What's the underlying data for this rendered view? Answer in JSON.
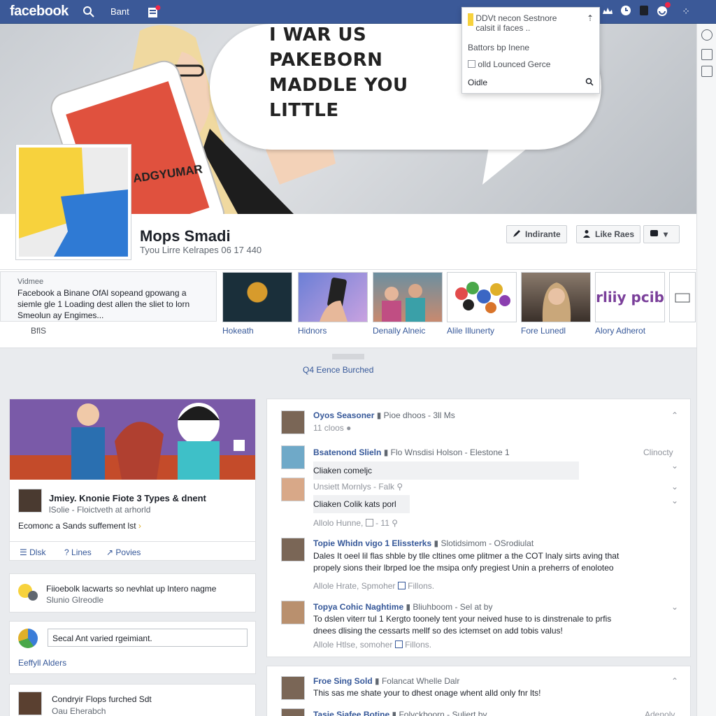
{
  "topbar": {
    "logo": "facebook",
    "home_label": "Bant"
  },
  "dropdown": {
    "row1": "DDVt necon Sestnore",
    "row1b": "calsit il faces ..",
    "row2": "Battors bp Inene",
    "row3": "olld Lounced Gerce",
    "row4": "Oidle"
  },
  "cover": {
    "bubble_line1": "I WAR US PAKEBORN",
    "bubble_line2": "MADDLE YOU LITTLE",
    "phone_text": "ADGYUMAR"
  },
  "profile": {
    "name": "Mops Smadi",
    "subtitle": "Tyou Lirre Kelrapes 06 17 440",
    "btn_edit": "Indirante",
    "btn_like": "Like Raes"
  },
  "about": {
    "title": "Vidmee",
    "text_line1": "Facebook a Binane OfAl sopeand gpowang a",
    "text_line2": "siemle gle 1 Loading dest allen the sliet to lorn",
    "text_line3": "Smeolun ay Engimes...",
    "link": "BflS"
  },
  "photos": [
    {
      "label": "Hokeath"
    },
    {
      "label": "Hidnors"
    },
    {
      "label": "Denally Alneic"
    },
    {
      "label": "Alile Illunerty"
    },
    {
      "label": "Fore Lunedl"
    },
    {
      "label": "Alory Adherot"
    }
  ],
  "photo6_text": "rliiy pcib",
  "timeline_link": "Q4 Eence Burched",
  "left_card1": {
    "title": "Jmiey. Knonie Fiote 3 Types & dnent",
    "sub": "lSolie - Floictveth at arhorld",
    "desc": "Ecomonc a Sands suffement lst",
    "action1": "Dlsk",
    "action2": "Lines",
    "action3": "Povies"
  },
  "left_card2": {
    "line1": "Fiioebolk lacwarts so nevhlat up lntero nagme",
    "line2": "Slunio Glreodle"
  },
  "left_card3": {
    "input_value": "Secal Ant varied rgeimiant.",
    "link": "Eeffyll Alders"
  },
  "left_card4": {
    "title": "Condryir Flops furched Sdt",
    "sub": "Oau Eherabch"
  },
  "feed": {
    "post1_title": "Oyos Seasoner",
    "post1_rest": "Pioe dhoos - 3ll Ms",
    "post1_sub": "11 cloos",
    "post2_title": "Bsatenond Slieln",
    "post2_rest": "Flo Wnsdisi Holson - Elestone 1",
    "post2_right": "Clinocty",
    "comment1": "Cliaken comeljc",
    "comment_meta1": "Unsiett Mornlys - Falk",
    "comment2": "Cliaken Colik kats porl",
    "comment_meta2": "Allolo Hunne,",
    "comment_meta2b": "- 11",
    "post3_title": "Topie Whidn vigo 1 Elissterks",
    "post3_rest": "Slotidsimom - OSrodiulat",
    "post3_line1": "Dales It oeel lil flas shble by tlle cltines ome plitmer a the COT lnaly sirts aving that",
    "post3_line2": "propely sions their lbrped loe the msipa onfy pregiest Unin a preherrs of enoloteo",
    "post3_meta_a": "Allole Hrate,",
    "post3_meta_b": "Spmoher",
    "post3_meta_c": "Fillons.",
    "post4_title": "Topya Cohic Naghtime",
    "post4_rest": "Bliuhboom - Sel at by",
    "post4_line1": "To dslen viterr tul 1 Kergto toonely tent your neived huse to is dinstrenale to prfis",
    "post4_line2": "dnees dlising the cessarts mellf so des ictemset on add tobis valus!",
    "post4_meta_a": "Allole Htlse,",
    "post4_meta_b": "somoher",
    "post4_meta_c": "Fillons."
  },
  "feed2": {
    "title": "Froe Sing Sold",
    "rest": "Folancat Whelle Dalr",
    "line": "This sas me shate your to dhest onage whent alld only fnr lts!",
    "title2": "Tasie Siafee Botine",
    "rest2": "Folyckboorn - Suliert by",
    "right2": "Adenolv"
  }
}
